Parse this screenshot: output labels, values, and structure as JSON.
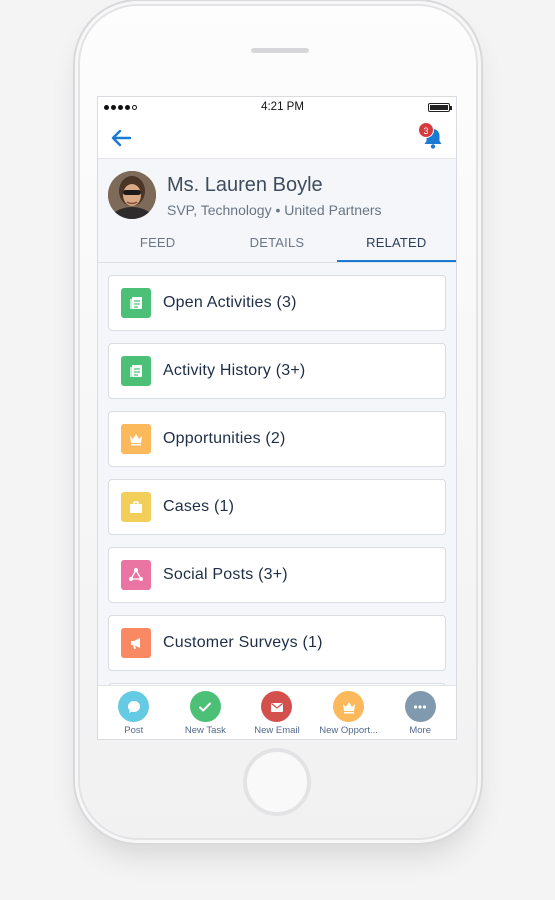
{
  "status": {
    "time": "4:21 PM"
  },
  "nav": {
    "notification_count": "3"
  },
  "contact": {
    "name": "Ms. Lauren Boyle",
    "subtitle": "SVP, Technology • United Partners"
  },
  "tabs": [
    {
      "label": "FEED"
    },
    {
      "label": "DETAILS"
    },
    {
      "label": "RELATED",
      "active": true
    }
  ],
  "related": [
    {
      "label": "Open Activities (3)",
      "icon": "notes-icon",
      "color": "#4bc076"
    },
    {
      "label": "Activity History (3+)",
      "icon": "notes-icon",
      "color": "#4bc076"
    },
    {
      "label": "Opportunities (2)",
      "icon": "crown-icon",
      "color": "#fcb95b"
    },
    {
      "label": "Cases (1)",
      "icon": "briefcase-icon",
      "color": "#f2cf5b"
    },
    {
      "label": "Social Posts (3+)",
      "icon": "share-icon",
      "color": "#ea74a2"
    },
    {
      "label": "Customer Surveys (1)",
      "icon": "megaphone-icon",
      "color": "#f88962"
    }
  ],
  "actions": [
    {
      "label": "Post",
      "icon": "chat-bubble-icon",
      "color": "#65cae4"
    },
    {
      "label": "New Task",
      "icon": "check-icon",
      "color": "#4bc076"
    },
    {
      "label": "New Email",
      "icon": "envelope-icon",
      "color": "#d4504c"
    },
    {
      "label": "New Opport...",
      "icon": "crown-icon",
      "color": "#fcb95b"
    },
    {
      "label": "More",
      "icon": "more-icon",
      "color": "#8199af"
    }
  ]
}
